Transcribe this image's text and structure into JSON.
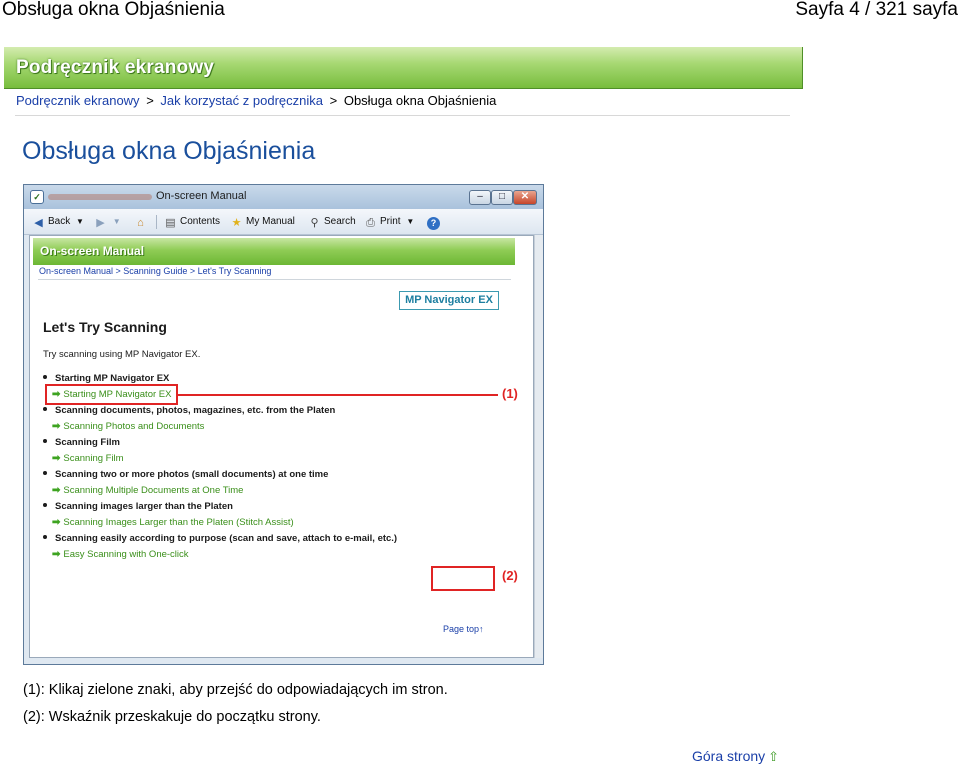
{
  "print_header": {
    "title": "Obsługa okna Objaśnienia",
    "page_info": "Sayfa 4 / 321 sayfa"
  },
  "banner": {
    "title": "Podręcznik ekranowy"
  },
  "breadcrumb": {
    "items": [
      "Podręcznik ekranowy",
      "Jak korzystać z podręcznika"
    ],
    "current": "Obsługa okna Objaśnienia",
    "separator": ">"
  },
  "page": {
    "title": "Obsługa okna Objaśnienia"
  },
  "screenshot": {
    "window_title": "On-screen Manual",
    "toolbar": {
      "back": "Back",
      "contents": "Contents",
      "my_manual": "My Manual",
      "search": "Search",
      "print": "Print"
    },
    "banner_title": "On-screen Manual",
    "crumb": "On-screen Manual > Scanning Guide > Let's Try Scanning",
    "mp_badge": "MP Navigator EX",
    "heading": "Let's Try Scanning",
    "intro": "Try scanning using MP Navigator EX.",
    "list": [
      {
        "type": "bullet",
        "text": "Starting MP Navigator EX"
      },
      {
        "type": "link",
        "text": "Starting MP Navigator EX"
      },
      {
        "type": "bullet",
        "text": "Scanning documents, photos, magazines, etc. from the Platen"
      },
      {
        "type": "link",
        "text": "Scanning Photos and Documents"
      },
      {
        "type": "bullet",
        "text": "Scanning Film"
      },
      {
        "type": "link",
        "text": "Scanning Film"
      },
      {
        "type": "bullet",
        "text": "Scanning two or more photos (small documents) at one time"
      },
      {
        "type": "link",
        "text": "Scanning Multiple Documents at One Time"
      },
      {
        "type": "bullet",
        "text": "Scanning images larger than the Platen"
      },
      {
        "type": "link",
        "text": "Scanning Images Larger than the Platen (Stitch Assist)"
      },
      {
        "type": "bullet",
        "text": "Scanning easily according to purpose (scan and save, attach to e-mail, etc.)"
      },
      {
        "type": "link",
        "text": "Easy Scanning with One-click"
      }
    ],
    "page_top": "Page top↑",
    "callouts": [
      "(1)",
      "(2)"
    ],
    "colors": {
      "callout": "#e02424",
      "link_green": "#3a8f1a",
      "banner_green": "#77bd3d"
    }
  },
  "captions": [
    "(1): Klikaj zielone znaki, aby przejść do odpowiadających im stron.",
    "(2): Wskaźnik przeskakuje do początku strony."
  ],
  "top_link": {
    "label": "Góra strony",
    "icon": "up-arrow-icon"
  }
}
